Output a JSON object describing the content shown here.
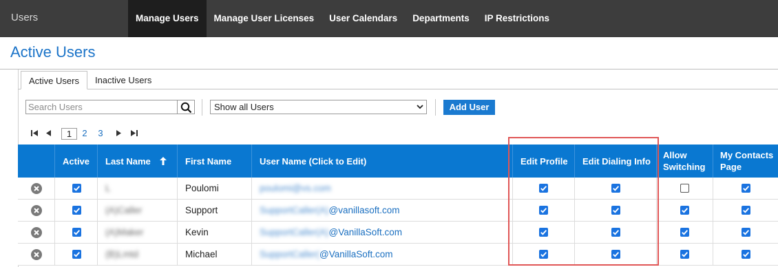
{
  "app": {
    "title": "Users"
  },
  "nav": {
    "items": [
      {
        "label": "Manage Users",
        "active": true
      },
      {
        "label": "Manage User Licenses",
        "active": false
      },
      {
        "label": "User Calendars",
        "active": false
      },
      {
        "label": "Departments",
        "active": false
      },
      {
        "label": "IP Restrictions",
        "active": false
      }
    ]
  },
  "page": {
    "title": "Active Users"
  },
  "tabs": [
    {
      "label": "Active Users",
      "active": true
    },
    {
      "label": "Inactive Users",
      "active": false
    }
  ],
  "toolbar": {
    "search_placeholder": "Search Users",
    "filter_selected": "Show all Users",
    "add_label": "Add User"
  },
  "pager": {
    "pages": [
      "1",
      "2",
      "3"
    ],
    "current": "1"
  },
  "table": {
    "columns": {
      "active": "Active",
      "last_name": "Last Name",
      "first_name": "First Name",
      "user_name": "User Name (Click to Edit)",
      "edit_profile": "Edit Profile",
      "edit_dialing": "Edit Dialing Info",
      "allow_switching_1": "Allow",
      "allow_switching_2": "Switching",
      "my_contacts_1": "My Contacts",
      "my_contacts_2": "Page"
    },
    "rows": [
      {
        "last_name": "L",
        "first_name": "Poulomi",
        "username_hidden": "poulomi@vs.com",
        "username_domain": "",
        "active": true,
        "edit_profile": true,
        "edit_dialing": true,
        "allow_switching": false,
        "my_contacts": true
      },
      {
        "last_name": "(A)Caller",
        "first_name": "Support",
        "username_hidden": "SupportCaller(A)",
        "username_domain": "@vanillasoft.com",
        "active": true,
        "edit_profile": true,
        "edit_dialing": true,
        "allow_switching": true,
        "my_contacts": true
      },
      {
        "last_name": "(A)Maker",
        "first_name": "Kevin",
        "username_hidden": "SupportCaller(A)",
        "username_domain": "@VanillaSoft.com",
        "active": true,
        "edit_profile": true,
        "edit_dialing": true,
        "allow_switching": true,
        "my_contacts": true
      },
      {
        "last_name": "(B)Lmtd",
        "first_name": "Michael",
        "username_hidden": "SupportCaller(",
        "username_domain": "@VanillaSoft.com",
        "active": true,
        "edit_profile": true,
        "edit_dialing": true,
        "allow_switching": true,
        "my_contacts": true
      }
    ]
  },
  "colors": {
    "nav_bg": "#3d3d3d",
    "accent": "#0a78d1",
    "title": "#1a73c8",
    "checkbox": "#1a73e0",
    "highlight": "#e05555"
  }
}
